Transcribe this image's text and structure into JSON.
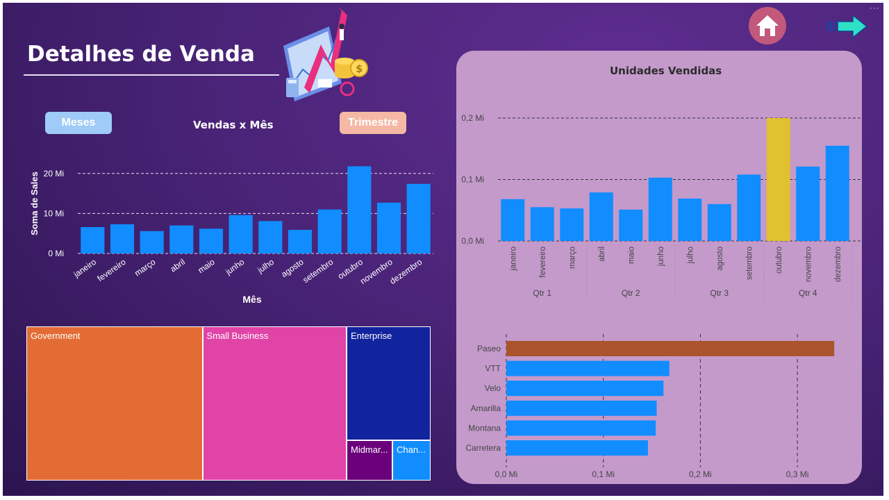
{
  "page": {
    "title": "Detalhes de Venda",
    "menu_dots": "···"
  },
  "nav": {
    "home_icon": "home-icon",
    "next_icon": "arrow-right-icon"
  },
  "buttons": {
    "meses": "Meses",
    "trimestre": "Trimestre"
  },
  "colors": {
    "bar_blue": "#118dff",
    "highlight_yellow": "#e0c12f",
    "highlight_brown": "#a9542b",
    "government": "#e36c35",
    "small_business": "#e044a7",
    "enterprise": "#12239e",
    "midmarket": "#6b007b",
    "channel": "#118dff"
  },
  "chart_data": [
    {
      "type": "bar",
      "title": "Vendas x Mês",
      "xlabel": "Mês",
      "ylabel": "Soma de Sales",
      "categories": [
        "janeiro",
        "fevereiro",
        "março",
        "abril",
        "maio",
        "junho",
        "julho",
        "agosto",
        "setembro",
        "outubro",
        "novembro",
        "dezembro"
      ],
      "values": [
        6.6,
        7.3,
        5.6,
        7.0,
        6.2,
        9.6,
        8.1,
        5.9,
        11.0,
        21.8,
        12.7,
        17.4
      ],
      "ylim": [
        0,
        25
      ],
      "yticks": [
        {
          "v": 0,
          "label": "0 Mi"
        },
        {
          "v": 10,
          "label": "10 Mi"
        },
        {
          "v": 20,
          "label": "20 Mi"
        }
      ],
      "grid": true
    },
    {
      "type": "bar",
      "title": "Unidades Vendidas",
      "categories": [
        "janeiro",
        "fevereiro",
        "março",
        "abril",
        "maio",
        "junho",
        "julho",
        "agosto",
        "setembro",
        "outubro",
        "novembro",
        "dezembro"
      ],
      "groups": [
        "Qtr 1",
        "Qtr 2",
        "Qtr 3",
        "Qtr 4"
      ],
      "values": [
        0.068,
        0.055,
        0.053,
        0.079,
        0.051,
        0.103,
        0.069,
        0.06,
        0.108,
        0.2,
        0.121,
        0.155
      ],
      "highlight_index": 9,
      "ylim": [
        0,
        0.2
      ],
      "yticks": [
        {
          "v": 0,
          "label": "0,0 Mi"
        },
        {
          "v": 0.1,
          "label": "0,1 Mi"
        },
        {
          "v": 0.2,
          "label": "0,2 Mi"
        }
      ],
      "grid": true
    },
    {
      "type": "bar",
      "orientation": "horizontal",
      "categories": [
        "Paseo",
        "VTT",
        "Velo",
        "Amarilla",
        "Montana",
        "Carretera"
      ],
      "values": [
        0.338,
        0.168,
        0.162,
        0.155,
        0.154,
        0.146
      ],
      "highlight_index": 0,
      "xlim": [
        0,
        0.35
      ],
      "xticks": [
        {
          "v": 0,
          "label": "0,0 Mi"
        },
        {
          "v": 0.1,
          "label": "0,1 Mi"
        },
        {
          "v": 0.2,
          "label": "0,2 Mi"
        },
        {
          "v": 0.3,
          "label": "0,3 Mi"
        }
      ],
      "grid": true
    },
    {
      "type": "treemap",
      "items": [
        {
          "name": "Government",
          "value": 44
        },
        {
          "name": "Small Business",
          "value": 36
        },
        {
          "name": "Enterprise",
          "value": 15.5
        },
        {
          "name": "Midmar...",
          "value": 3
        },
        {
          "name": "Chan...",
          "value": 2.5
        }
      ]
    }
  ]
}
